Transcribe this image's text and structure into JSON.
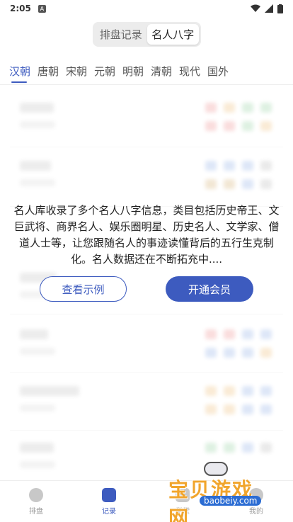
{
  "status_bar": {
    "time": "2:05",
    "notif_glyph": "A"
  },
  "segmented": {
    "options": [
      "排盘记录",
      "名人八字"
    ],
    "active_index": 1
  },
  "dynasty_tabs": [
    "汉朝",
    "唐朝",
    "宋朝",
    "元朝",
    "明朝",
    "清朝",
    "现代",
    "国外"
  ],
  "active_tab": 0,
  "promo": {
    "line1": "名人库收录了多个名人八字信息，类目包括历史帝王、文",
    "line2": "巨武将、商界名人、娱乐圈明星、历史名人、文学家、僧",
    "line3": "道人士等，让您跟随名人的事迹读懂背后的五行生克制",
    "line4": "化。名人数据还在不断拓充中....",
    "example_button": "查看示例",
    "member_button": "开通会员"
  },
  "bottom_nav": [
    {
      "label": "排盘",
      "icon": "chart-icon"
    },
    {
      "label": "记录",
      "icon": "calendar-icon"
    },
    {
      "label": "学堂",
      "icon": "book-icon"
    },
    {
      "label": "我的",
      "icon": "profile-icon"
    }
  ],
  "watermark": {
    "brand": "宝贝游戏网",
    "url": "baobeiy.com"
  },
  "colors": {
    "accent": "#3d5bbf",
    "watermark_orange": "#f1a52c"
  }
}
